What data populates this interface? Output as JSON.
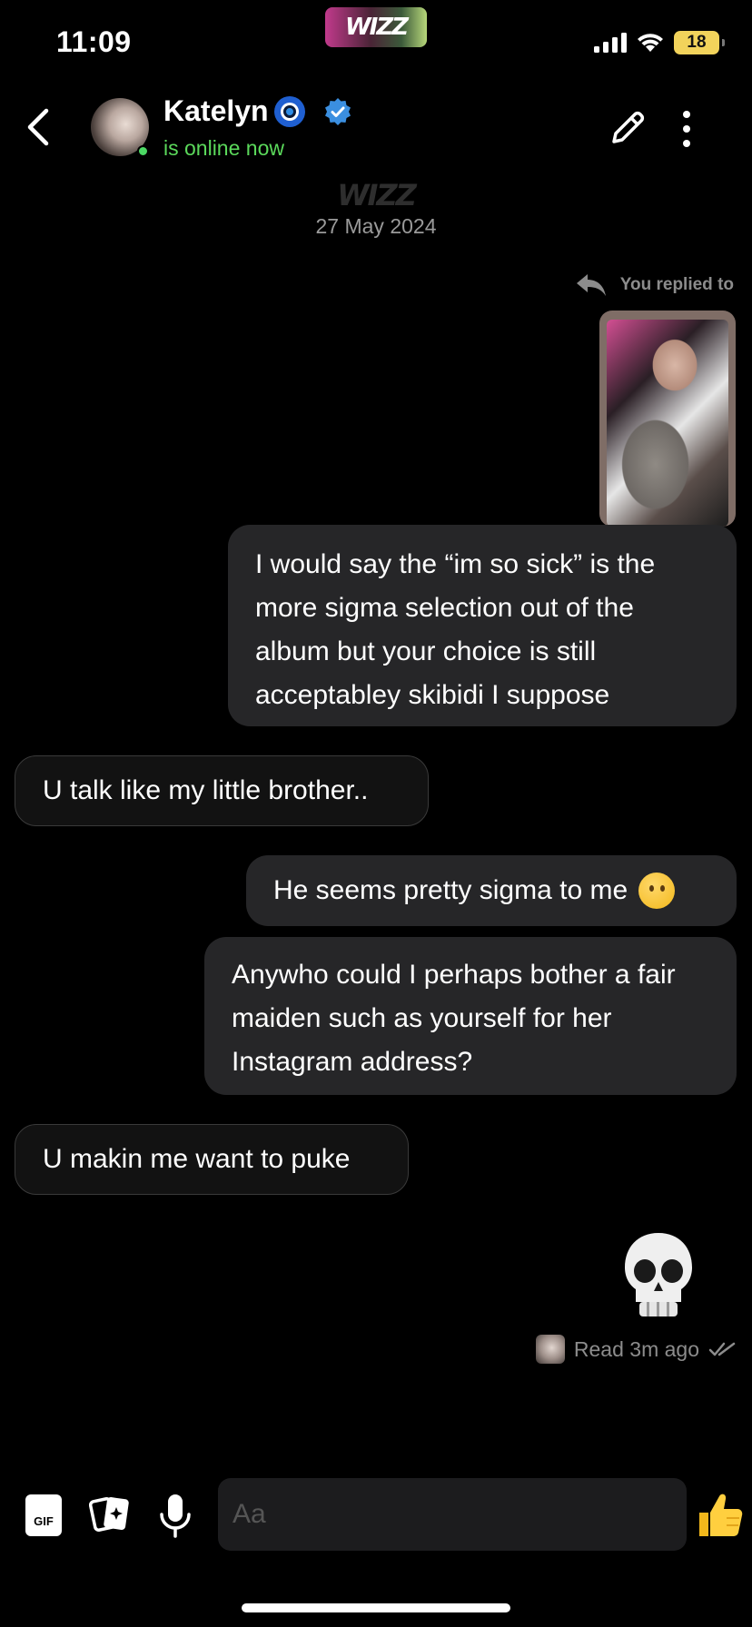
{
  "status_bar": {
    "time": "11:09",
    "app_badge": "WIZZ",
    "battery": "18"
  },
  "header": {
    "contact_name": "Katelyn",
    "name_emoji": "nazar-amulet-icon",
    "verified": true,
    "status": "is online now",
    "status_color": "#5bd95b"
  },
  "conversation": {
    "brand_mark": "WIZZ",
    "date": "27 May 2024",
    "reply_label": "You replied to",
    "messages": [
      {
        "from": "me",
        "text": "I would say the “im so sick” is the more sigma selection out of the album but your choice is still acceptabley skibidi I suppose"
      },
      {
        "from": "them",
        "text": "U talk like my little brother.."
      },
      {
        "from": "me",
        "text": "He seems pretty sigma to me",
        "emoji": "thinking-face"
      },
      {
        "from": "me",
        "text": "Anywho could I perhaps bother a fair maiden such as yourself for her Instagram address?"
      },
      {
        "from": "them",
        "text": "U makin me want to puke"
      },
      {
        "from": "me",
        "emoji": "skull"
      }
    ],
    "read_receipt": "Read 3m ago"
  },
  "composer": {
    "gif_label": "GIF",
    "placeholder": "Aa"
  },
  "colors": {
    "background": "#000000",
    "sent_bubble": "#262628",
    "received_bubble": "#121212",
    "online_green": "#4cd964",
    "verified_blue": "#3b8fe0"
  }
}
